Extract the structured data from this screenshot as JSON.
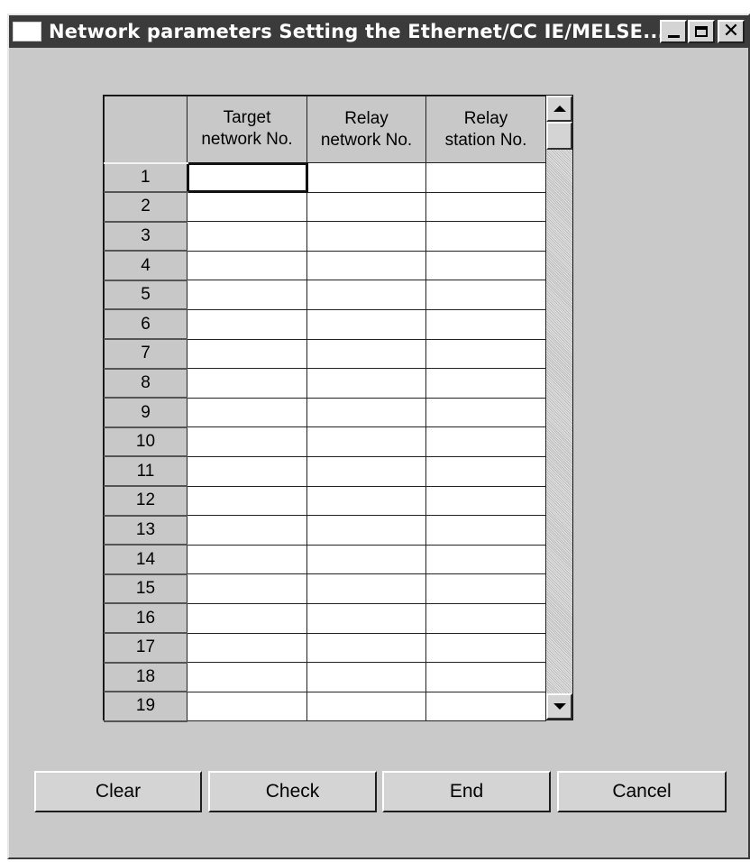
{
  "window": {
    "title": "Network parameters  Setting the Ethernet/CC IE/MELSE..."
  },
  "grid": {
    "columns": [
      "",
      "Target\nnetwork No.",
      "Relay\nnetwork No.",
      "Relay\nstation No."
    ],
    "rows": [
      {
        "num": "1",
        "target": "",
        "relay_net": "",
        "relay_station": ""
      },
      {
        "num": "2",
        "target": "",
        "relay_net": "",
        "relay_station": ""
      },
      {
        "num": "3",
        "target": "",
        "relay_net": "",
        "relay_station": ""
      },
      {
        "num": "4",
        "target": "",
        "relay_net": "",
        "relay_station": ""
      },
      {
        "num": "5",
        "target": "",
        "relay_net": "",
        "relay_station": ""
      },
      {
        "num": "6",
        "target": "",
        "relay_net": "",
        "relay_station": ""
      },
      {
        "num": "7",
        "target": "",
        "relay_net": "",
        "relay_station": ""
      },
      {
        "num": "8",
        "target": "",
        "relay_net": "",
        "relay_station": ""
      },
      {
        "num": "9",
        "target": "",
        "relay_net": "",
        "relay_station": ""
      },
      {
        "num": "10",
        "target": "",
        "relay_net": "",
        "relay_station": ""
      },
      {
        "num": "11",
        "target": "",
        "relay_net": "",
        "relay_station": ""
      },
      {
        "num": "12",
        "target": "",
        "relay_net": "",
        "relay_station": ""
      },
      {
        "num": "13",
        "target": "",
        "relay_net": "",
        "relay_station": ""
      },
      {
        "num": "14",
        "target": "",
        "relay_net": "",
        "relay_station": ""
      },
      {
        "num": "15",
        "target": "",
        "relay_net": "",
        "relay_station": ""
      },
      {
        "num": "16",
        "target": "",
        "relay_net": "",
        "relay_station": ""
      },
      {
        "num": "17",
        "target": "",
        "relay_net": "",
        "relay_station": ""
      },
      {
        "num": "18",
        "target": "",
        "relay_net": "",
        "relay_station": ""
      },
      {
        "num": "19",
        "target": "",
        "relay_net": "",
        "relay_station": ""
      }
    ]
  },
  "buttons": {
    "clear": "Clear",
    "check": "Check",
    "end": "End",
    "cancel": "Cancel"
  },
  "icons": {
    "window_icon": "window-icon",
    "minimize": "minimize-icon",
    "maximize": "maximize-icon",
    "close": "close-icon",
    "scroll_up": "arrow-up-icon",
    "scroll_down": "arrow-down-icon"
  }
}
